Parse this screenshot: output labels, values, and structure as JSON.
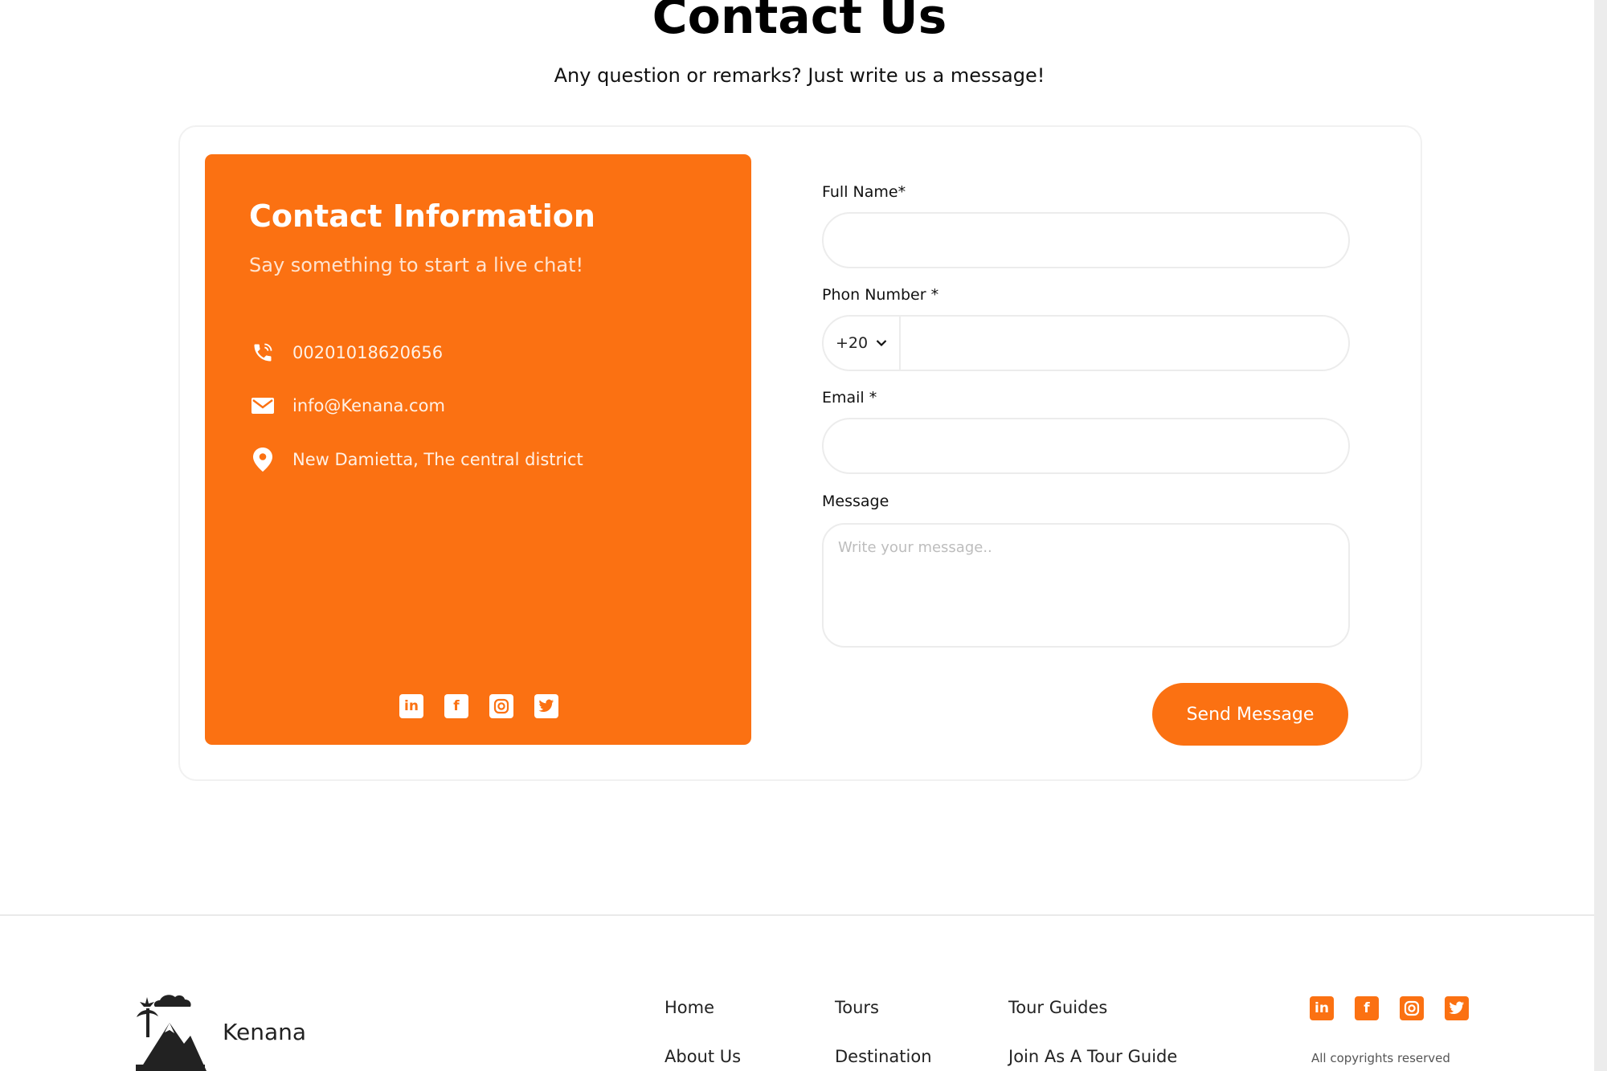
{
  "header": {
    "title": "Contact Us",
    "subtitle": "Any question or remarks? Just write us a message!"
  },
  "contact_info": {
    "title": "Contact Information",
    "subtitle": "Say something to start a live chat!",
    "phone": "00201018620656",
    "email": "info@Kenana.com",
    "address": "New Damietta, The central district",
    "icons": [
      "phone-icon",
      "mail-icon",
      "location-pin-icon"
    ],
    "social_icons": [
      "linkedin-icon",
      "facebook-icon",
      "instagram-icon",
      "twitter-icon"
    ]
  },
  "form": {
    "full_name_label": "Full Name*",
    "full_name_value": "",
    "phone_label": "Phon Number *",
    "phone_prefix": "+20",
    "phone_value": "",
    "email_label": "Email *",
    "email_value": "",
    "message_label": "Message",
    "message_placeholder": "Write your message..",
    "submit_label": "Send Message"
  },
  "footer": {
    "brand": "Kenana",
    "links": {
      "home": "Home",
      "about": "About Us",
      "tours": "Tours",
      "destination": "Destination",
      "tour_guides": "Tour Guides",
      "join_guide": "Join As A Tour Guide"
    },
    "copyright": "All copyrights reserved",
    "social_icons": [
      "linkedin-icon",
      "facebook-icon",
      "instagram-icon",
      "twitter-icon"
    ]
  },
  "colors": {
    "accent": "#fb7112",
    "background": "#ffffff",
    "border": "#ececec"
  }
}
